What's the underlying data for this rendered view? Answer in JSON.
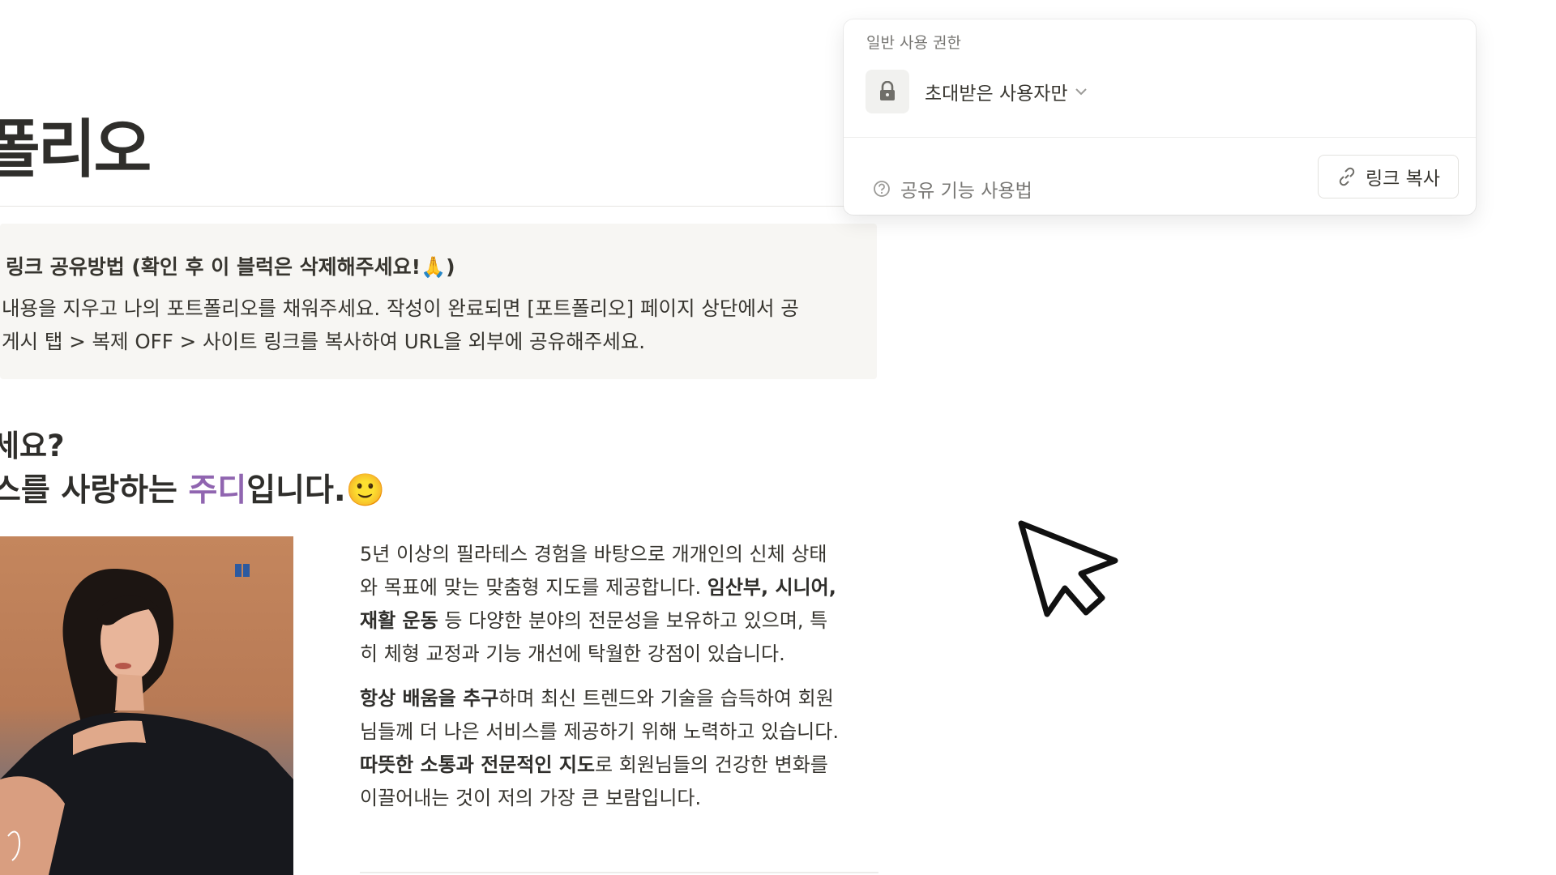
{
  "page": {
    "title": "폴리오",
    "callout": {
      "title": "링크 공유방법 (확인 후 이 블럭은 삭제해주세요!🙏)",
      "line1": "내용을 지우고 나의 포트폴리오를 채워주세요. 작성이 완료되면 [포트폴리오] 페이지 상단에서 공",
      "line2": "게시 탭 > 복제 OFF > 사이트 링크를 복사하여 URL을 외부에 공유해주세요."
    },
    "heading_question": "세요?",
    "heading_intro": {
      "before": "스를 사랑하는 ",
      "name": "주디",
      "after": "입니다.",
      "emoji": "🙂"
    },
    "para1": {
      "l1": "5년 이상의 필라테스 경험을 바탕으로 개개인의 신체 상태",
      "l2a": "와 목표에 맞는 맞춤형 지도를 제공합니다. ",
      "l2b": "임산부, 시니어,",
      "l3a": "재활 운동",
      "l3b": " 등 다양한 분야의 전문성을 보유하고 있으며, 특",
      "l4": "히 체형 교정과 기능 개선에 탁월한 강점이 있습니다."
    },
    "para2": {
      "l1a": "항상 배움을 추구",
      "l1b": "하며 최신 트렌드와 기술을 습득하여 회원",
      "l2": "님들께 더 나은 서비스를 제공하기 위해 노력하고 있습니다.",
      "l3a": "따뜻한 소통과 전문적인 지도",
      "l3b": "로 회원님들의 건강한 변화를",
      "l4": "이끌어내는 것이 저의 가장 큰 보람입니다."
    }
  },
  "share_panel": {
    "permission_label": "일반 사용 권한",
    "permission_value": "초대받은 사용자만",
    "help_link": "공유 기능 사용법",
    "copy_link_button": "링크 복사",
    "icons": [
      "lock-icon",
      "chevron-down-icon",
      "question-circle-icon",
      "link-icon"
    ]
  },
  "colors": {
    "name_highlight": "#9065b0",
    "callout_bg": "#f7f6f3",
    "text": "#37352f",
    "muted": "#787774"
  }
}
